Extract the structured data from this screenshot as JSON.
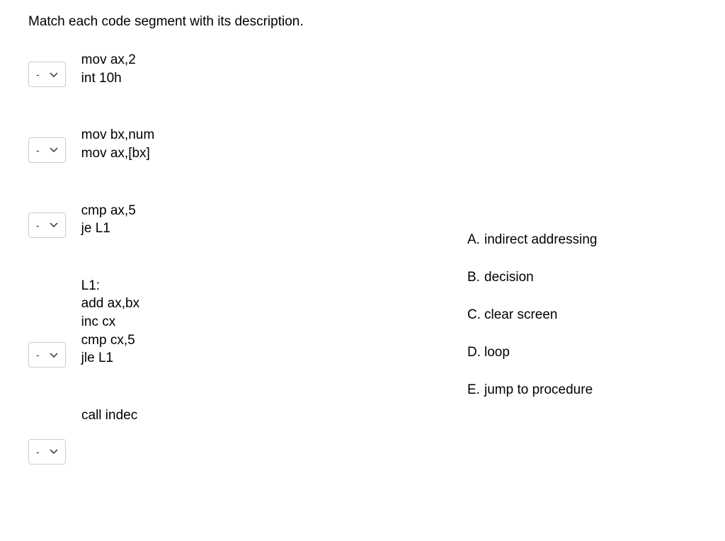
{
  "prompt": "Match each code segment with its description.",
  "items": [
    {
      "selected": "-",
      "code": "mov ax,2\nint 10h"
    },
    {
      "selected": "-",
      "code": "mov bx,num\nmov ax,[bx]"
    },
    {
      "selected": "-",
      "code": "cmp ax,5\nje L1"
    },
    {
      "selected": "-",
      "code": "L1:\nadd ax,bx\ninc cx\ncmp cx,5\njle L1"
    },
    {
      "selected": "-",
      "code": "call indec"
    }
  ],
  "answers": [
    {
      "letter": "A.",
      "text": "indirect addressing"
    },
    {
      "letter": "B.",
      "text": "decision"
    },
    {
      "letter": "C.",
      "text": "clear screen"
    },
    {
      "letter": "D.",
      "text": "loop"
    },
    {
      "letter": "E.",
      "text": "jump to procedure"
    }
  ]
}
